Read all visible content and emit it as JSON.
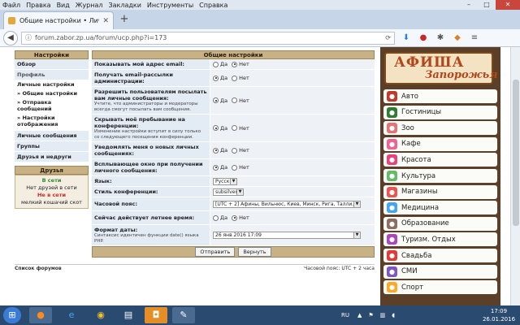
{
  "menu": [
    "Файл",
    "Правка",
    "Вид",
    "Журнал",
    "Закладки",
    "Инструменты",
    "Справка"
  ],
  "tab": {
    "title": "Общие настройки • Личн…"
  },
  "url": "forum.zabor.zp.ua/forum/ucp.php?i=173",
  "left": {
    "head": "Настройки",
    "overview": "Обзор",
    "profile": "Профиль",
    "personal": "Личные настройки",
    "sub1": "» Общие настройки",
    "sub2": "» Отправка сообщений",
    "sub3": "» Настройки отображения",
    "pm": "Личные сообщения",
    "groups": "Группы",
    "friends_foes": "Друзья и недруги",
    "friends_head": "Друзья",
    "online": "В сети",
    "no_friends_online": "Нет друзей в сети",
    "offline": "Не в сети",
    "offline_friend": "мелкий кошачий скот"
  },
  "main": {
    "head": "Общие настройки",
    "yes": "Да",
    "no": "Нет",
    "rows": [
      {
        "label": "Показывать мой адрес email:",
        "note": "",
        "value": "no"
      },
      {
        "label": "Получать email-рассылки администрации:",
        "note": "",
        "value": "yes"
      },
      {
        "label": "Разрешить пользователям посылать вам личные сообщения:",
        "note": "Учтите, что администраторы и модераторы всегда смогут посылать вам сообщения.",
        "value": "yes"
      },
      {
        "label": "Скрывать моё пребывание на конференции:",
        "note": "Изменение настройки вступит в силу только со следующего посещения конференции.",
        "value": "yes"
      },
      {
        "label": "Уведомлять меня о новых личных сообщениях:",
        "note": "",
        "value": "yes"
      },
      {
        "label": "Всплывающее окно при получении личного сообщения:",
        "note": "",
        "value": "yes"
      }
    ],
    "language_label": "Язык:",
    "language_value": "Русский",
    "style_label": "Стиль конференции:",
    "style_value": "subsilver2",
    "tz_label": "Часовой пояс:",
    "tz_value": "[UTC + 2] Афины, Вильнюс, Киев, Минск, Рига, Талли…",
    "dst_label": "Сейчас действует летнее время:",
    "dst_value": "no",
    "date_label": "Формат даты:",
    "date_note": "Синтаксис идентичен функции date() языка PHP.",
    "date_value": "26 янв 2016 17:09",
    "submit": "Отправить",
    "reset": "Вернуть"
  },
  "footer": {
    "left": "Список форумов",
    "right": "Часовой пояс: UTC + 2 часа"
  },
  "banner": {
    "line1": "АФИША",
    "line2": "Запорожья"
  },
  "categories": [
    {
      "label": "Авто",
      "color": "#c0392b",
      "icon": "car-icon"
    },
    {
      "label": "Гостиницы",
      "color": "#2e7d32",
      "icon": "hotel-icon"
    },
    {
      "label": "Зоо",
      "color": "#e57373",
      "icon": "paw-icon"
    },
    {
      "label": "Кафе",
      "color": "#f06292",
      "icon": "cup-icon"
    },
    {
      "label": "Красота",
      "color": "#ec407a",
      "icon": "lips-icon"
    },
    {
      "label": "Культура",
      "color": "#66bb6a",
      "icon": "mask-icon"
    },
    {
      "label": "Магазины",
      "color": "#ef5350",
      "icon": "bag-icon"
    },
    {
      "label": "Медицина",
      "color": "#42a5f5",
      "icon": "medical-icon"
    },
    {
      "label": "Образование",
      "color": "#8d6e63",
      "icon": "book-icon"
    },
    {
      "label": "Туризм. Отдых",
      "color": "#ab47bc",
      "icon": "star-icon"
    },
    {
      "label": "Свадьба",
      "color": "#e53935",
      "icon": "heart-icon"
    },
    {
      "label": "СМИ",
      "color": "#7e57c2",
      "icon": "media-icon"
    },
    {
      "label": "Спорт",
      "color": "#ffa726",
      "icon": "ball-icon"
    }
  ],
  "tray": {
    "lang": "RU",
    "time": "17:09",
    "date": "26.01.2016"
  }
}
